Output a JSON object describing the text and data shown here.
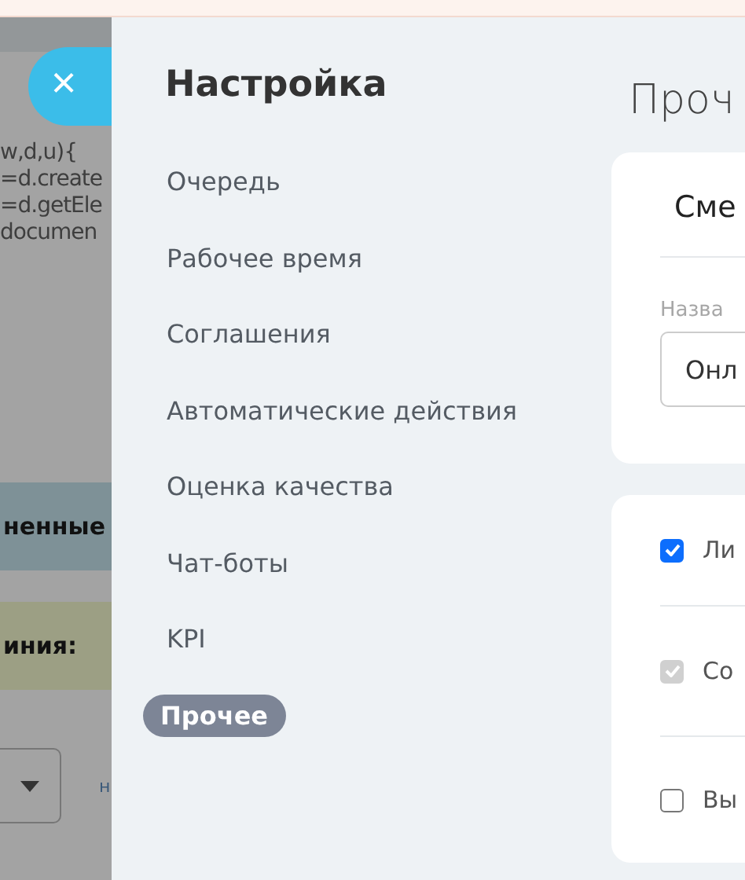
{
  "background": {
    "code_lines": [
      "w,d,u){",
      "=d.create",
      "=d.getEle",
      "documen"
    ],
    "banners": [
      {
        "text": "ненные",
        "color": "#7e9197"
      },
      {
        "text": "иния:",
        "color": "#9c9f84"
      }
    ],
    "link": "н"
  },
  "close_button": {
    "label": "×"
  },
  "sidebar": {
    "title": "Настройка",
    "items": [
      {
        "label": "Очередь",
        "selected": false
      },
      {
        "label": "Рабочее время",
        "selected": false
      },
      {
        "label": "Соглашения",
        "selected": false
      },
      {
        "label": "Автоматические действия",
        "selected": false
      },
      {
        "label": "Оценка качества",
        "selected": false
      },
      {
        "label": "Чат-боты",
        "selected": false
      },
      {
        "label": "KPI",
        "selected": false
      },
      {
        "label": "Прочее",
        "selected": true
      }
    ]
  },
  "content": {
    "title": "Проч",
    "card": {
      "title": "Сме",
      "field_label": "Назва",
      "field_value": "Онл"
    },
    "options": [
      {
        "label": "Ли",
        "checked": true,
        "disabled": false
      },
      {
        "label": "Со",
        "checked": true,
        "disabled": true
      },
      {
        "label": "Вы",
        "checked": false,
        "disabled": false
      }
    ]
  }
}
